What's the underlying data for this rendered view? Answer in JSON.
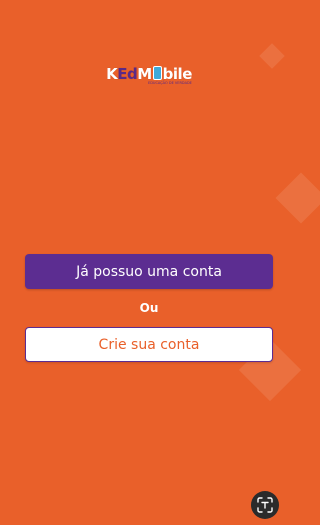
{
  "logo": {
    "part_k": "K",
    "part_ed": "Ed",
    "part_m": "M",
    "part_bile": "bile",
    "tagline": "EDUCAÇÃO DE VERDADE"
  },
  "actions": {
    "login_label": "Já possuo uma conta",
    "divider_label": "Ou",
    "signup_label": "Crie sua conta"
  },
  "colors": {
    "background": "#E9602A",
    "primary": "#5C2D91",
    "secondary_bg": "#FFFFFF",
    "secondary_text": "#E9602A",
    "fab": "#2B2B2B"
  },
  "icons": {
    "floating_button": "scan-text-icon"
  }
}
